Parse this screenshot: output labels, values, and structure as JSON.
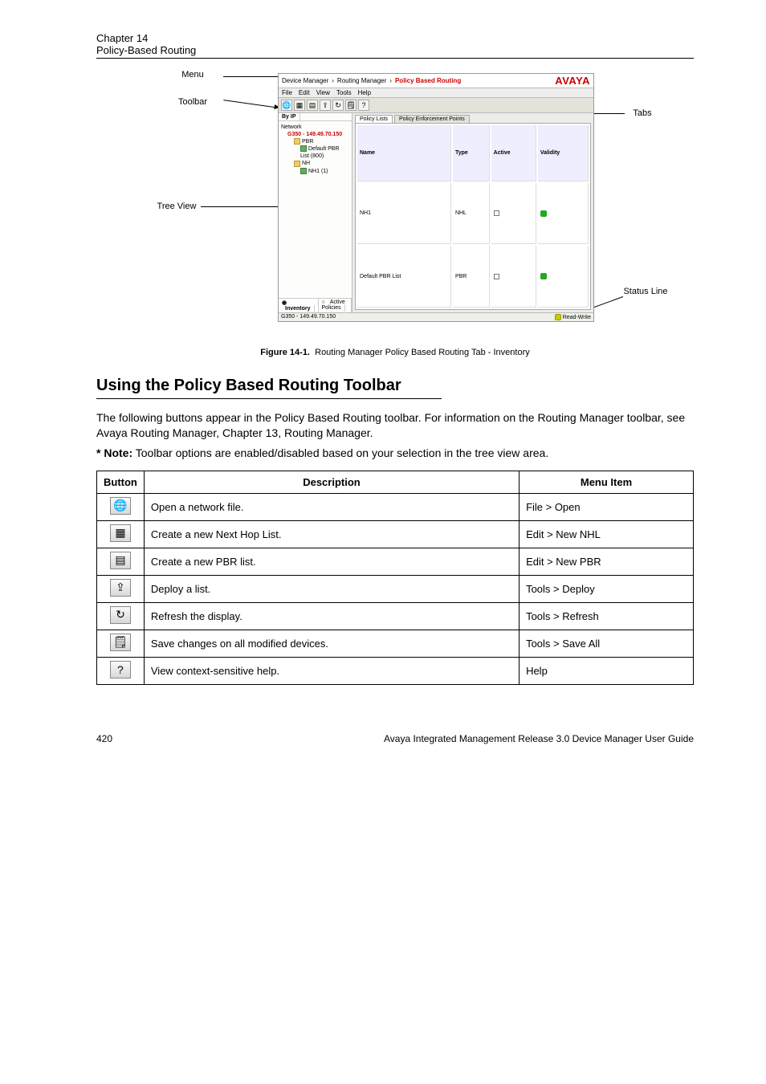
{
  "doc": {
    "chapter_line": "Chapter 14",
    "chapter_title": "Policy-Based Routing",
    "fig_num": "Figure 14-1.",
    "fig_caption": "Routing Manager Policy Based Routing Tab - Inventory",
    "section": "Using the Policy Based Routing Toolbar",
    "para1": "The following buttons appear in the Policy Based Routing toolbar. For information on the Routing Manager toolbar, see Avaya Routing Manager, Chapter 13, Routing Manager.",
    "note_tag": "* Note:",
    "note_body": "Toolbar options are enabled/disabled based on your selection in the tree view area.",
    "footer_left": "420",
    "footer_right": "Avaya Integrated Management Release 3.0 Device Manager User Guide",
    "callouts": {
      "menu": "Menu",
      "toolbar": "Toolbar",
      "tabs": "Tabs",
      "treeview": "Tree View",
      "status": "Status Line"
    }
  },
  "app": {
    "breadcrumb": [
      "Device Manager",
      "Routing Manager",
      "Policy Based Routing"
    ],
    "logo": "AVAYA",
    "menu": [
      "File",
      "Edit",
      "View",
      "Tools",
      "Help"
    ],
    "sidebar_tabs": [
      "By IP"
    ],
    "sidebar_bottom": [
      "Inventory",
      "Active Policies"
    ],
    "tree": {
      "group": "Network",
      "device": "G350 - 149.49.70.150",
      "folders": [
        {
          "name": "PBR",
          "children": [
            "Default PBR List (800)"
          ]
        },
        {
          "name": "NH",
          "children": [
            "NH1 (1)"
          ]
        }
      ]
    },
    "main_tabs": [
      "Policy Lists",
      "Policy Enforcement Points"
    ],
    "columns": [
      "Name",
      "Type",
      "Active",
      "Validity"
    ],
    "rows": [
      {
        "name": "NH1",
        "type": "NHL",
        "active": false,
        "valid": true
      },
      {
        "name": "Default PBR List",
        "type": "PBR",
        "active": false,
        "valid": true
      }
    ],
    "status_left": "G350 - 149.49.70.150",
    "status_right": "Read-Write"
  },
  "buttons_table": {
    "headers": [
      "Button",
      "Description",
      "Menu Item"
    ],
    "rows": [
      {
        "icon": "🌐",
        "name": "open-network-icon",
        "desc": "Open a network file.",
        "menu": "File > Open"
      },
      {
        "icon": "▦",
        "name": "new-nhl-icon",
        "desc": "Create a new Next Hop List.",
        "menu": "Edit > New NHL"
      },
      {
        "icon": "▤",
        "name": "new-pbr-icon",
        "desc": "Create a new PBR list.",
        "menu": "Edit > New PBR"
      },
      {
        "icon": "⇪",
        "name": "deploy-icon",
        "desc": "Deploy a list.",
        "menu": "Tools > Deploy"
      },
      {
        "icon": "↻",
        "name": "refresh-icon",
        "desc": "Refresh the display.",
        "menu": "Tools > Refresh"
      },
      {
        "icon": "🗒",
        "name": "save-all-icon",
        "desc": "Save changes on all modified devices.",
        "menu": "Tools > Save All"
      },
      {
        "icon": "?",
        "name": "help-icon",
        "desc": "View context-sensitive help.",
        "menu": "Help"
      }
    ]
  }
}
